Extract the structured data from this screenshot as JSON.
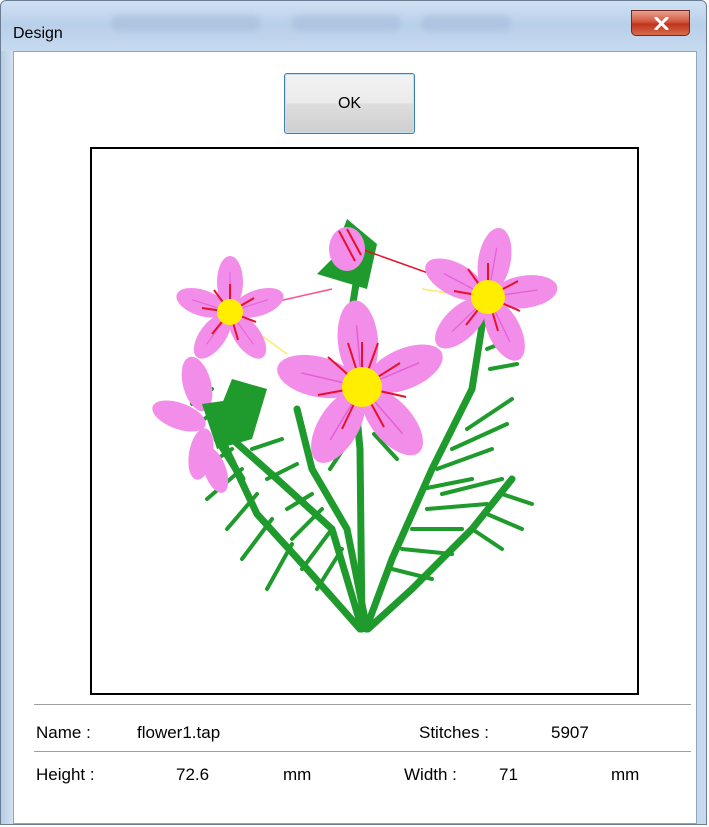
{
  "window": {
    "title": "Design",
    "close_glyph": "x"
  },
  "ok_button": {
    "label": "OK"
  },
  "preview": {
    "description_icon": "embroidery-flower-icon"
  },
  "info": {
    "name_label": "Name :",
    "name_value": "flower1.tap",
    "stitches_label": "Stitches :",
    "stitches_value": "5907",
    "height_label": "Height :",
    "height_value": "72.6",
    "height_unit": "mm",
    "width_label": "Width :",
    "width_value": "71",
    "width_unit": "mm"
  },
  "colors": {
    "stem_green": "#1f9a2c",
    "petal_pink": "#f08be8",
    "center_yellow": "#ffee00",
    "stamen_red": "#e8102a"
  }
}
